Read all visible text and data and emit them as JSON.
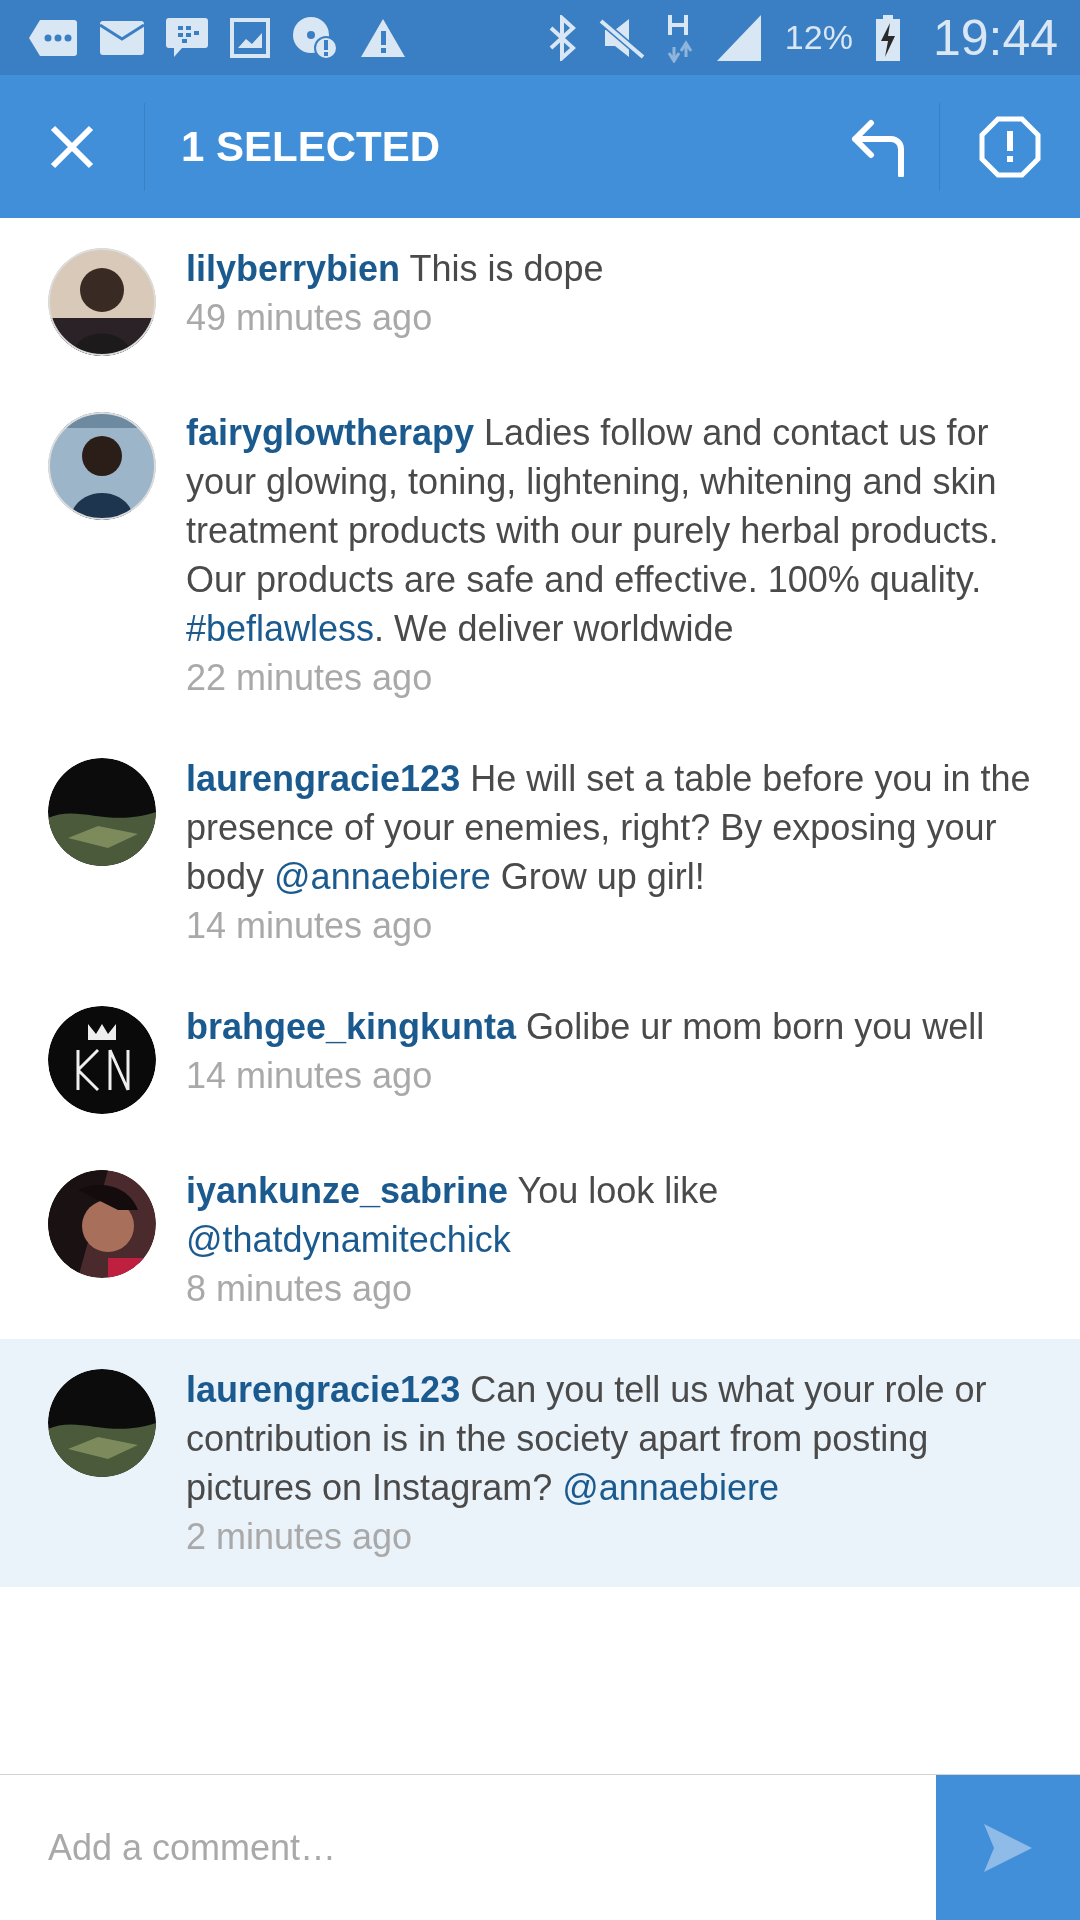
{
  "status_bar": {
    "battery": "12%",
    "time": "19:44"
  },
  "app_bar": {
    "title": "1 SELECTED"
  },
  "comments": [
    {
      "username": "lilyberrybien",
      "segments": [
        {
          "kind": "plain",
          "text": "This is dope"
        }
      ],
      "time": "49 minutes ago",
      "selected": false
    },
    {
      "username": "fairyglowtherapy",
      "segments": [
        {
          "kind": "plain",
          "text": "Ladies follow and contact us for your glowing, toning, lightening, whitening and skin treatment products with our purely herbal products. Our products are safe and effective. 100% quality. "
        },
        {
          "kind": "hashtag",
          "text": "#beflawless"
        },
        {
          "kind": "plain",
          "text": ". We deliver worldwide"
        }
      ],
      "time": "22 minutes ago",
      "selected": false
    },
    {
      "username": "laurengracie123",
      "segments": [
        {
          "kind": "plain",
          "text": "He will set a table before you in the presence of your enemies, right? By exposing your body "
        },
        {
          "kind": "mention",
          "text": "@annaebiere"
        },
        {
          "kind": "plain",
          "text": " Grow up girl!"
        }
      ],
      "time": "14 minutes ago",
      "selected": false
    },
    {
      "username": "brahgee_kingkunta",
      "segments": [
        {
          "kind": "plain",
          "text": "Golibe ur mom born you well"
        }
      ],
      "time": "14 minutes ago",
      "selected": false
    },
    {
      "username": "iyankunze_sabrine",
      "segments": [
        {
          "kind": "plain",
          "text": "You look like "
        },
        {
          "kind": "mention",
          "text": "@thatdynamitechick"
        }
      ],
      "time": "8 minutes ago",
      "selected": false
    },
    {
      "username": "laurengracie123",
      "segments": [
        {
          "kind": "plain",
          "text": "Can you tell us what your role or contribution is in the society apart from posting pictures on Instagram? "
        },
        {
          "kind": "mention",
          "text": "@annaebiere"
        }
      ],
      "time": "2 minutes ago",
      "selected": true
    }
  ],
  "composer": {
    "placeholder": "Add a comment…"
  }
}
